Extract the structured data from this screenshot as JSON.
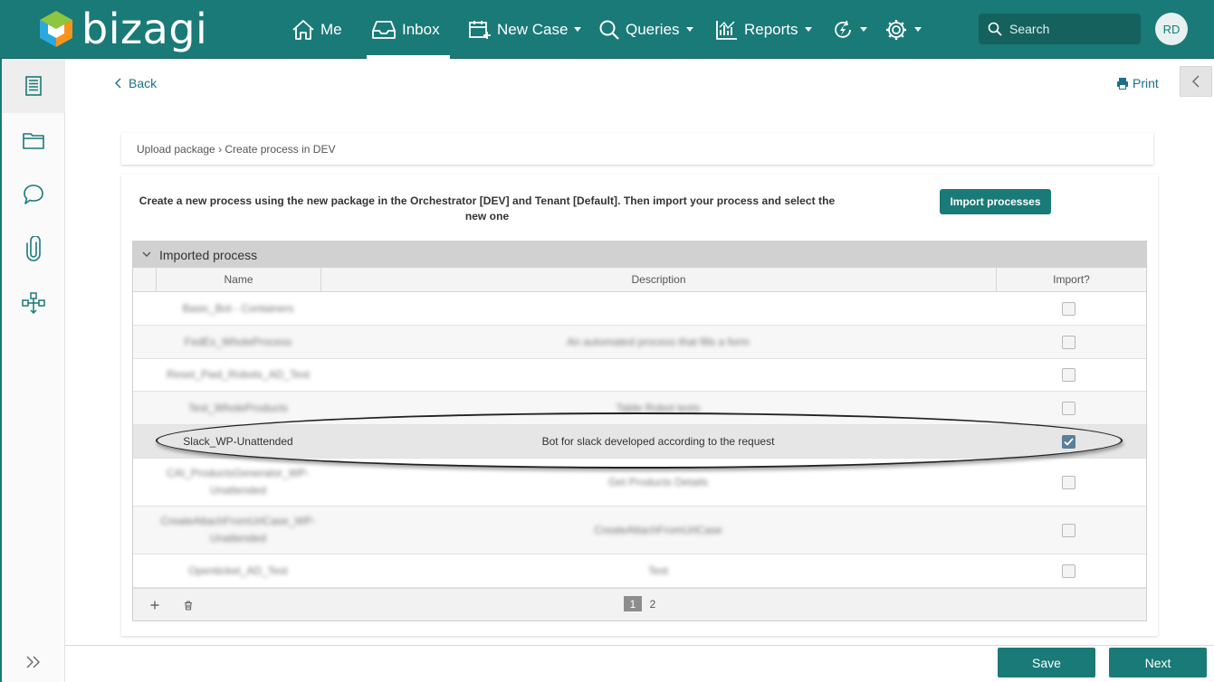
{
  "app": {
    "name": "bizagi",
    "brand_color": "#197a77"
  },
  "nav": {
    "me": "Me",
    "inbox": "Inbox",
    "new_case": "New Case",
    "queries": "Queries",
    "reports": "Reports",
    "active": "inbox"
  },
  "search": {
    "placeholder": "Search"
  },
  "user": {
    "initials": "RD"
  },
  "sidebar": {
    "items": [
      {
        "icon": "list-icon",
        "active": true
      },
      {
        "icon": "folder-icon",
        "active": false
      },
      {
        "icon": "chat-icon",
        "active": false
      },
      {
        "icon": "paperclip-icon",
        "active": false
      },
      {
        "icon": "process-map-icon",
        "active": false
      }
    ],
    "expand_icon": "double-chevron-right-icon"
  },
  "toolbar": {
    "back_label": "Back",
    "print_label": "Print"
  },
  "breadcrumb": "Upload package › Create process in DEV",
  "instructions": "Create a new process using the new package in the Orchestrator [DEV] and Tenant [Default]. Then import your process and select the new one",
  "import_button_label": "Import processes",
  "grid": {
    "title": "Imported process",
    "columns": [
      "Name",
      "Description",
      "Import?"
    ],
    "rows": [
      {
        "name": "Basic_Bot - Containers",
        "description": "",
        "checked": false,
        "blurred": true
      },
      {
        "name": "FedEx_WholeProcess",
        "description": "An automated process that fills a form",
        "checked": false,
        "blurred": true
      },
      {
        "name": "Reset_Pwd_Robots_AD_Test",
        "description": "",
        "checked": false,
        "blurred": true
      },
      {
        "name": "Test_WholeProducts",
        "description": "Table Robot tests",
        "checked": false,
        "blurred": true
      },
      {
        "name": "Slack_WP-Unattended",
        "description": "Bot for slack developed according to the request",
        "checked": true,
        "blurred": false
      },
      {
        "name": "CAI_ProductsGenerator_WP-Unattended",
        "description": "Get Products Details",
        "checked": false,
        "blurred": true
      },
      {
        "name": "CreateAttachFromUrlCase_WP-Unattended",
        "description": "CreateAttachFromUrlCase",
        "checked": false,
        "blurred": true
      },
      {
        "name": "Openticket_AD_Test",
        "description": "Test",
        "checked": false,
        "blurred": true
      }
    ],
    "pages": [
      "1",
      "2"
    ],
    "current_page": "1"
  },
  "footer": {
    "save_label": "Save",
    "next_label": "Next"
  }
}
